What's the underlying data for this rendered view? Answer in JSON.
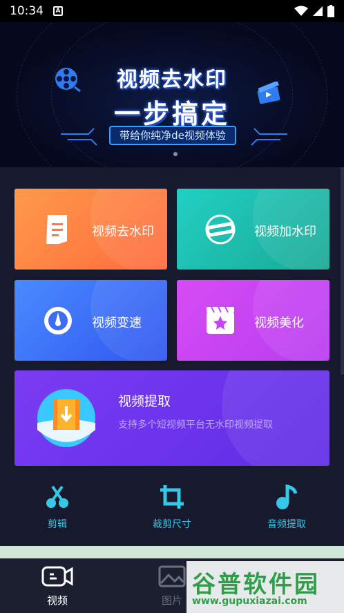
{
  "status_bar": {
    "time": "10:34",
    "notification_icon": "A"
  },
  "banner": {
    "headline_line1": "视频去水印",
    "headline_line2": "一步搞定",
    "tagline": "带给你纯净de视频体验"
  },
  "features": [
    {
      "label": "视频去水印",
      "icon": "document-icon"
    },
    {
      "label": "视频加水印",
      "icon": "watermark-stamp-icon"
    },
    {
      "label": "视频变速",
      "icon": "speedometer-icon"
    },
    {
      "label": "视频美化",
      "icon": "clapperboard-star-icon"
    }
  ],
  "extract": {
    "title": "视频提取",
    "subtitle": "支持多个短视频平台无水印视频提取",
    "icon": "film-download-icon"
  },
  "tools": [
    {
      "label": "剪辑",
      "icon": "scissors-icon"
    },
    {
      "label": "裁剪尺寸",
      "icon": "crop-icon"
    },
    {
      "label": "音频提取",
      "icon": "music-note-icon"
    }
  ],
  "nav": [
    {
      "label": "视频",
      "icon": "video-camera-icon",
      "active": true
    },
    {
      "label": "图片",
      "icon": "image-icon",
      "active": false
    }
  ],
  "watermark": {
    "text": "谷普软件园",
    "url": "www.gupuxiazai.com"
  },
  "colors": {
    "accent_cyan": "#35c8e8",
    "card_orange": "#ff7a3d",
    "card_teal": "#1fbcae",
    "card_blue": "#3a6cf6",
    "card_purple": "#c744f2",
    "card_violet": "#6a33ea"
  }
}
